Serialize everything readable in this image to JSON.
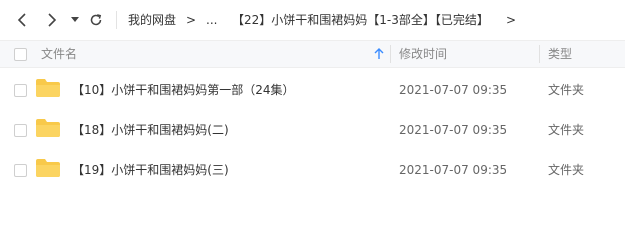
{
  "toolbar": {
    "back_icon": "chevron-left-icon",
    "forward_icon": "chevron-right-icon",
    "history_icon": "caret-down-icon",
    "refresh_icon": "refresh-icon",
    "breadcrumb": {
      "root": "我的网盘",
      "sep1": ">",
      "ellipsis": "...",
      "current": "【22】小饼干和围裙妈妈【1-3部全】【已完结】",
      "sep_end": ">"
    }
  },
  "table": {
    "columns": {
      "name": "文件名",
      "modified": "修改时间",
      "type": "类型"
    },
    "sort_icon": "arrow-up-icon",
    "rows": [
      {
        "name": "【10】小饼干和围裙妈妈第一部（24集）",
        "modified": "2021-07-07 09:35",
        "type": "文件夹"
      },
      {
        "name": "【18】小饼干和围裙妈妈(二)",
        "modified": "2021-07-07 09:35",
        "type": "文件夹"
      },
      {
        "name": "【19】小饼干和围裙妈妈(三)",
        "modified": "2021-07-07 09:35",
        "type": "文件夹"
      }
    ]
  },
  "colors": {
    "folder": "#f8c94a",
    "accent": "#3b8cff",
    "header_bg": "#f7f8fa"
  }
}
